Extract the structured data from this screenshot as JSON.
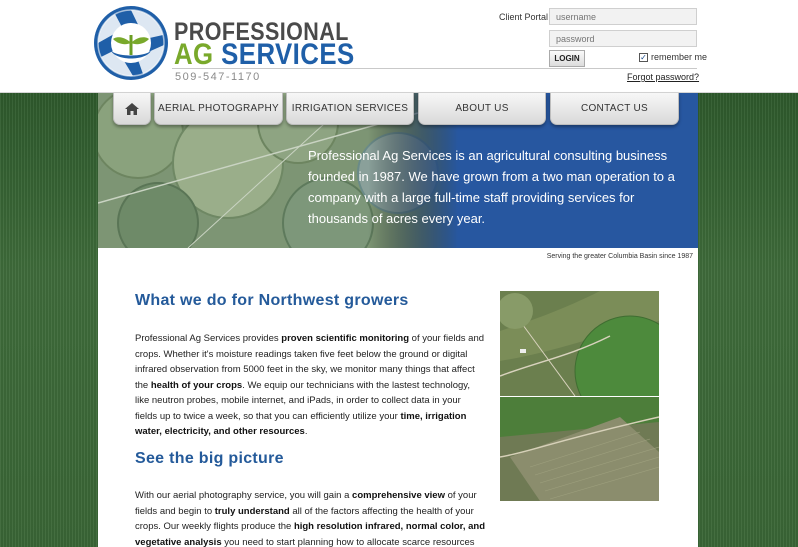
{
  "header": {
    "logo_line1": "PROFESSIONAL",
    "logo_ag": "AG",
    "logo_services": "SERVICES",
    "phone": "509-547-1170"
  },
  "login": {
    "portal_label": "Client Portal",
    "username_placeholder": "username",
    "password_placeholder": "password",
    "remember_label": "remember me",
    "remember_checked": true,
    "login_label": "LOGIN",
    "forgot_label": "Forgot password?"
  },
  "nav": {
    "home_icon": "home-icon",
    "items": [
      {
        "label": "AERIAL PHOTOGRAPHY"
      },
      {
        "label": "IRRIGATION SERVICES"
      },
      {
        "label": "ABOUT US"
      },
      {
        "label": "CONTACT US"
      }
    ]
  },
  "banner": {
    "text": "Professional Ag Services is an agricultural consulting business founded in 1987. We have grown from a two man operation to a company with a large full-time staff providing services for thousands of acres every year.",
    "caption": "Serving the greater Columbia Basin since 1987"
  },
  "section1": {
    "heading": "What we do for Northwest growers",
    "p_a": "Professional Ag Services provides ",
    "p_b": "proven scientific monitoring",
    "p_c": " of your fields and crops. Whether it's moisture readings taken five feet below the ground or digital infrared observation from 5000 feet in the sky, we monitor many things that affect the ",
    "p_d": "health of your crops",
    "p_e": ". We equip our technicians with the lastest technology, like neutron probes, mobile internet, and iPads, in order to collect data in your fields up to twice a week, so that you can efficiently utilize your ",
    "p_f": "time, irrigation water, electricity, and other resources",
    "p_g": "."
  },
  "section2": {
    "heading": "See the big picture",
    "p_a": "With our aerial photography service, you will gain a ",
    "p_b": "comprehensive view",
    "p_c": " of your fields and begin to ",
    "p_d": "truly understand",
    "p_e": " all of the factors affecting the health of your crops. Our weekly flights produce the ",
    "p_f": "high resolution infrared, normal color, and vegetative analysis",
    "p_g": " you need to start planning how to allocate scarce resources more effectively. Thanks to the ability to accurately visualize any variations in"
  },
  "colors": {
    "brand_blue": "#245a9a",
    "brand_green": "#79a92b",
    "backdrop_green": "#3a6636"
  }
}
